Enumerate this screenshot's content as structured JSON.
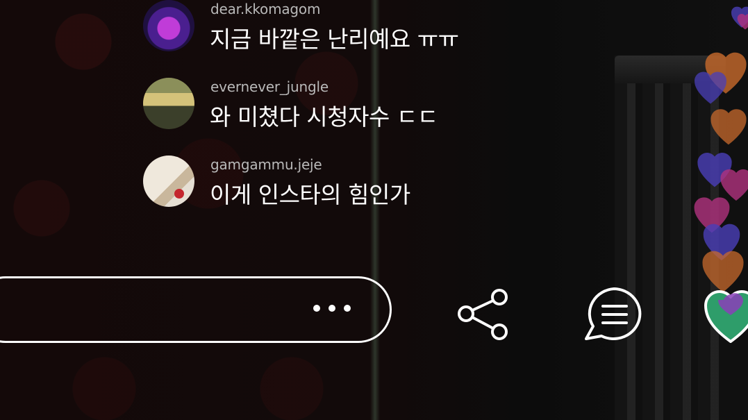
{
  "comments": [
    {
      "username": "dear.kkomagom",
      "message": "지금 바깥은 난리예요 ㅠㅠ",
      "avatar": "purple-light-avatar"
    },
    {
      "username": "evernever_jungle",
      "message": "와 미쳤다 시청자수 ㄷㄷ",
      "avatar": "cafe-interior-avatar"
    },
    {
      "username": "gamgammu.jeje",
      "message": "이게 인스타의 힘인가",
      "avatar": "flowers-avatar"
    }
  ],
  "input": {
    "more_icon": "ellipsis-icon"
  },
  "actions": {
    "share_icon": "share-icon",
    "chat_icon": "chat-bubble-icon",
    "like_icon": "heart-icon",
    "like_color": "#2e9d6a"
  },
  "floating_hearts": {
    "colors": [
      "#4a3fb8",
      "#c86a2c",
      "#b0327e"
    ]
  }
}
